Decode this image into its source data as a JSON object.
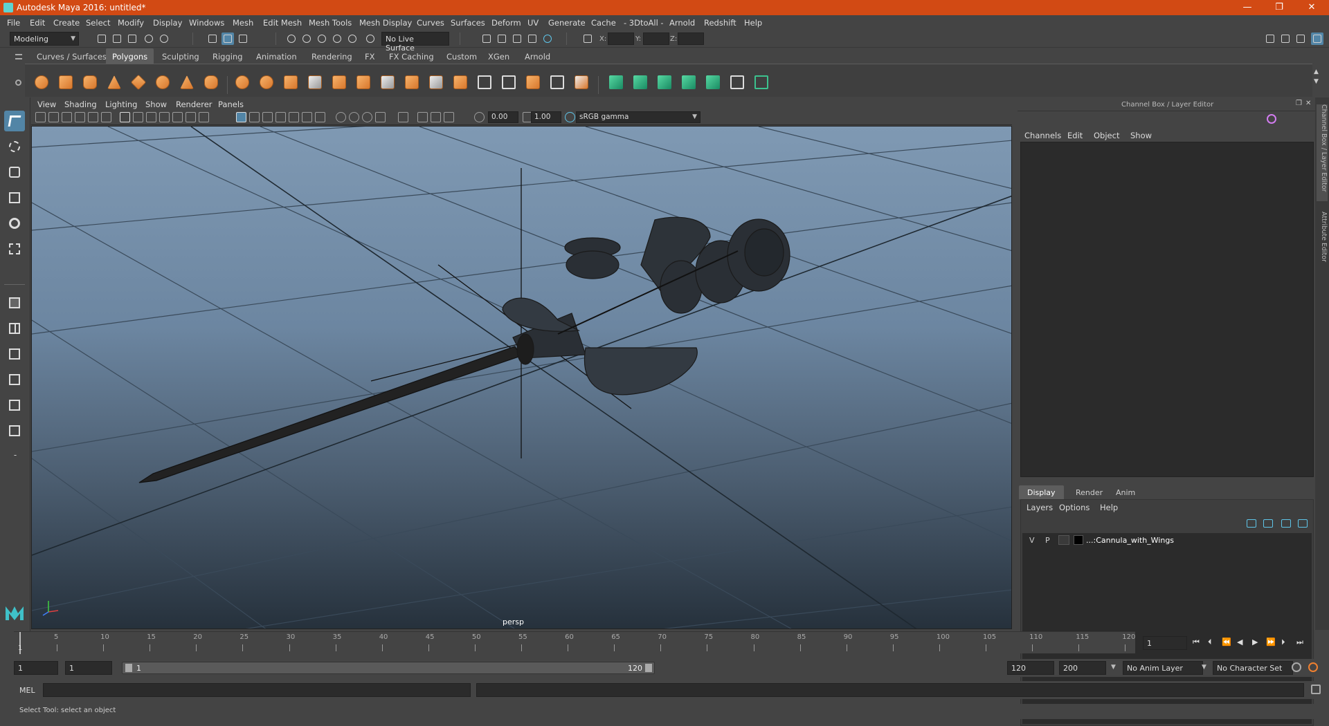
{
  "window": {
    "title": "Autodesk Maya 2016: untitled*",
    "controls": [
      "—",
      "❐",
      "✕"
    ]
  },
  "menubar": [
    "File",
    "Edit",
    "Create",
    "Select",
    "Modify",
    "Display",
    "Windows",
    "Mesh",
    "Edit Mesh",
    "Mesh Tools",
    "Mesh Display",
    "Curves",
    "Surfaces",
    "Deform",
    "UV",
    "Generate",
    "Cache",
    "- 3DtoAll -",
    "Arnold",
    "Redshift",
    "Help"
  ],
  "statusline": {
    "mode": "Modeling",
    "live_surface": "No Live Surface",
    "x_label": "X:",
    "y_label": "Y:",
    "z_label": "Z:"
  },
  "shelf_tabs": [
    {
      "label": "Curves / Surfaces",
      "active": false
    },
    {
      "label": "Polygons",
      "active": true
    },
    {
      "label": "Sculpting",
      "active": false
    },
    {
      "label": "Rigging",
      "active": false
    },
    {
      "label": "Animation",
      "active": false
    },
    {
      "label": "Rendering",
      "active": false
    },
    {
      "label": "FX",
      "active": false
    },
    {
      "label": "FX Caching",
      "active": false
    },
    {
      "label": "Custom",
      "active": false
    },
    {
      "label": "XGen",
      "active": false
    },
    {
      "label": "Arnold",
      "active": false
    }
  ],
  "viewport": {
    "menus": [
      "View",
      "Shading",
      "Lighting",
      "Show",
      "Renderer",
      "Panels"
    ],
    "exposure": "0.00",
    "gamma": "1.00",
    "colorspace": "sRGB gamma",
    "camera": "persp",
    "accent": "#5285a6"
  },
  "channel_box": {
    "title": "Channel Box / Layer Editor",
    "menus": [
      "Channels",
      "Edit",
      "Object",
      "Show"
    ]
  },
  "layer_editor": {
    "tabs": [
      {
        "label": "Display",
        "active": true
      },
      {
        "label": "Render",
        "active": false
      },
      {
        "label": "Anim",
        "active": false
      }
    ],
    "menus": [
      "Layers",
      "Options",
      "Help"
    ],
    "layers": [
      {
        "v": "V",
        "p": "P",
        "name": "...:Cannula_with_Wings"
      }
    ]
  },
  "side_tabs": [
    "Channel Box / Layer Editor",
    "Attribute Editor"
  ],
  "timeline": {
    "ticks": [
      "5",
      "10",
      "15",
      "20",
      "25",
      "30",
      "35",
      "40",
      "45",
      "50",
      "55",
      "60",
      "65",
      "70",
      "75",
      "80",
      "85",
      "90",
      "95",
      "100",
      "105",
      "110",
      "115",
      "120"
    ],
    "start_marker": "1",
    "current_frame": "1"
  },
  "range": {
    "start": "1",
    "playback_start": "1",
    "range_start": "1",
    "range_end": "120",
    "playback_end": "120",
    "end": "200",
    "anim_layer": "No Anim Layer",
    "character_set": "No Character Set"
  },
  "command_line": {
    "lang": "MEL"
  },
  "help_line": "Select Tool: select an object"
}
